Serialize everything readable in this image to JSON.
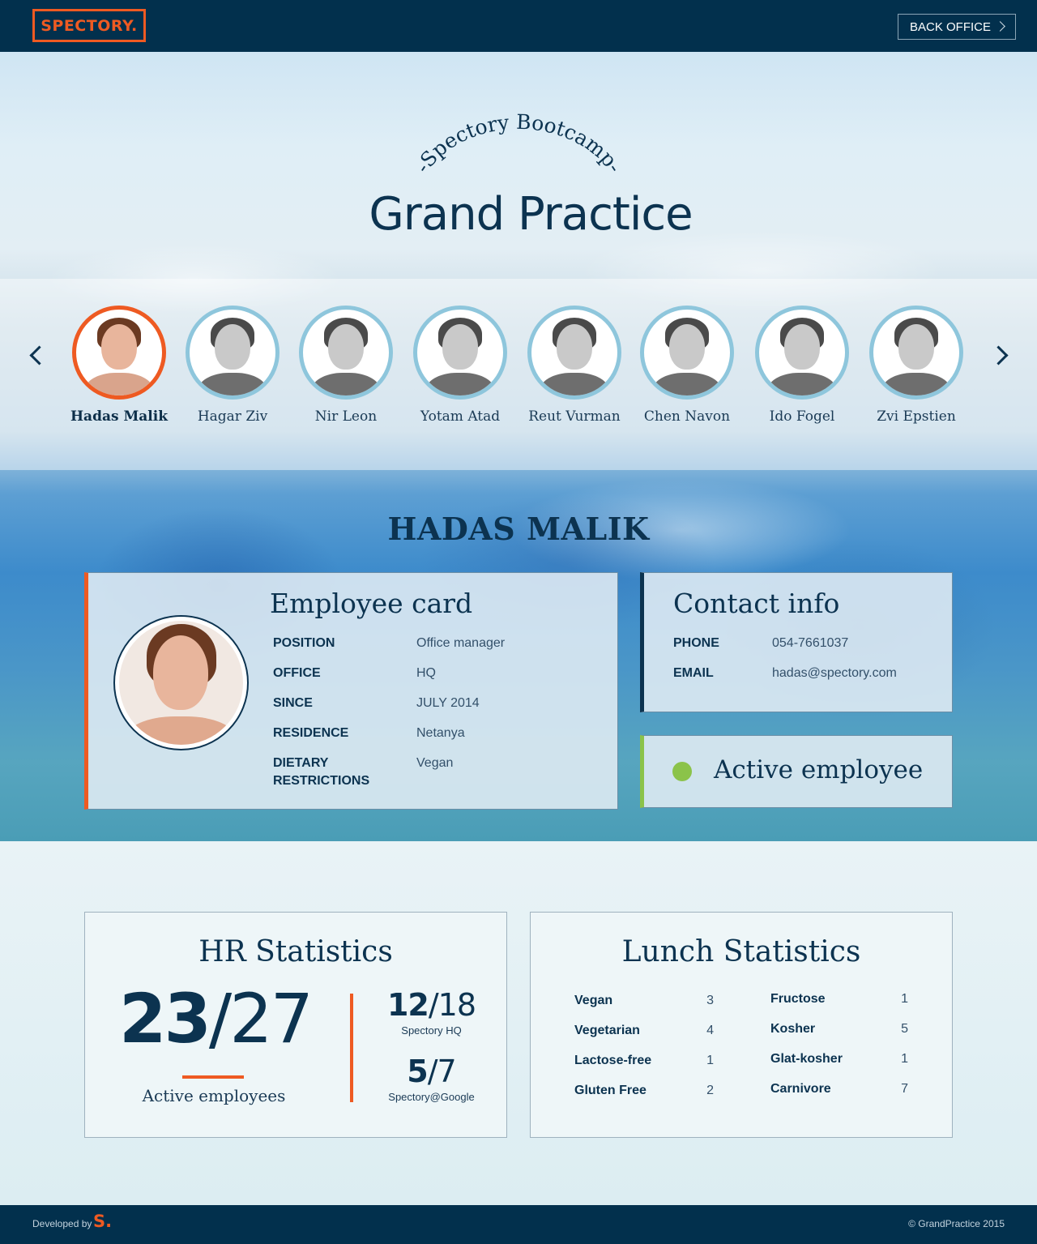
{
  "header": {
    "logo": "SPECTORY.",
    "back_office": "BACK OFFICE"
  },
  "hero": {
    "subtitle": "-Spectory Bootcamp-",
    "title": "Grand Practice"
  },
  "people": [
    {
      "name": "Hadas Malik",
      "selected": true
    },
    {
      "name": "Hagar Ziv"
    },
    {
      "name": "Nir Leon"
    },
    {
      "name": "Yotam Atad"
    },
    {
      "name": "Reut Vurman"
    },
    {
      "name": "Chen Navon"
    },
    {
      "name": "Ido Fogel"
    },
    {
      "name": "Zvi Epstien"
    }
  ],
  "employee": {
    "name": "HADAS MALIK",
    "card_title": "Employee card",
    "fields": [
      {
        "label": "POSITION",
        "value": "Office manager"
      },
      {
        "label": "OFFICE",
        "value": "HQ"
      },
      {
        "label": "SINCE",
        "value": "JULY 2014"
      },
      {
        "label": "RESIDENCE",
        "value": "Netanya"
      },
      {
        "label": "DIETARY\nRESTRICTIONS",
        "value": "Vegan"
      }
    ]
  },
  "contact": {
    "title": "Contact info",
    "fields": [
      {
        "label": "PHONE",
        "value": "054-7661037"
      },
      {
        "label": "EMAIL",
        "value": "hadas@spectory.com"
      }
    ]
  },
  "status": {
    "label": "Active employee",
    "color": "#8bc34a"
  },
  "hr_stats": {
    "title": "HR Statistics",
    "active": "23",
    "total": "/27",
    "caption": "Active employees",
    "offices": [
      {
        "active": "12",
        "total": "/18",
        "label": "Spectory HQ"
      },
      {
        "active": "5",
        "total": "/7",
        "label": "Spectory@Google"
      }
    ]
  },
  "lunch_stats": {
    "title": "Lunch Statistics",
    "left": [
      {
        "label": "Vegan",
        "count": "3"
      },
      {
        "label": "Vegetarian",
        "count": "4"
      },
      {
        "label": "Lactose-free",
        "count": "1"
      },
      {
        "label": "Gluten Free",
        "count": "2"
      }
    ],
    "right": [
      {
        "label": "Fructose",
        "count": "1"
      },
      {
        "label": "Kosher",
        "count": "5"
      },
      {
        "label": "Glat-kosher",
        "count": "1"
      },
      {
        "label": "Carnivore",
        "count": "7"
      }
    ]
  },
  "footer": {
    "developed_by": "Developed by",
    "logo": "S.",
    "copyright": "© GrandPractice 2015"
  },
  "colors": {
    "navy": "#02304d",
    "accent": "#ee5a22",
    "active": "#8bc34a",
    "avatar_ring": "#8ec6dc"
  }
}
